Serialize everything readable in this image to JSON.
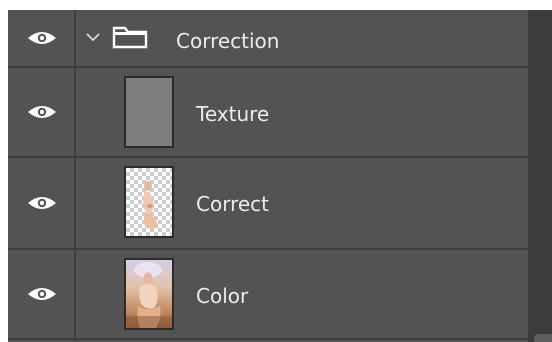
{
  "panel": {
    "colors": {
      "row_background": "#535353",
      "divider": "#3e3e3e",
      "text": "#ececec",
      "icon": "#ffffff"
    }
  },
  "layers": [
    {
      "name": "Correction",
      "type": "group",
      "expanded": true,
      "visible": true,
      "visibility_icon": "eye-icon",
      "expand_icon": "chevron-down-icon",
      "type_icon": "folder-icon"
    },
    {
      "name": "Texture",
      "type": "layer",
      "visible": true,
      "visibility_icon": "eye-icon",
      "thumbnail": "gray-texture-thumbnail"
    },
    {
      "name": "Correct",
      "type": "layer",
      "visible": true,
      "visibility_icon": "eye-icon",
      "thumbnail": "transparent-figure-thumbnail"
    },
    {
      "name": "Color",
      "type": "layer",
      "visible": true,
      "visibility_icon": "eye-icon",
      "thumbnail": "photo-figure-thumbnail"
    }
  ]
}
